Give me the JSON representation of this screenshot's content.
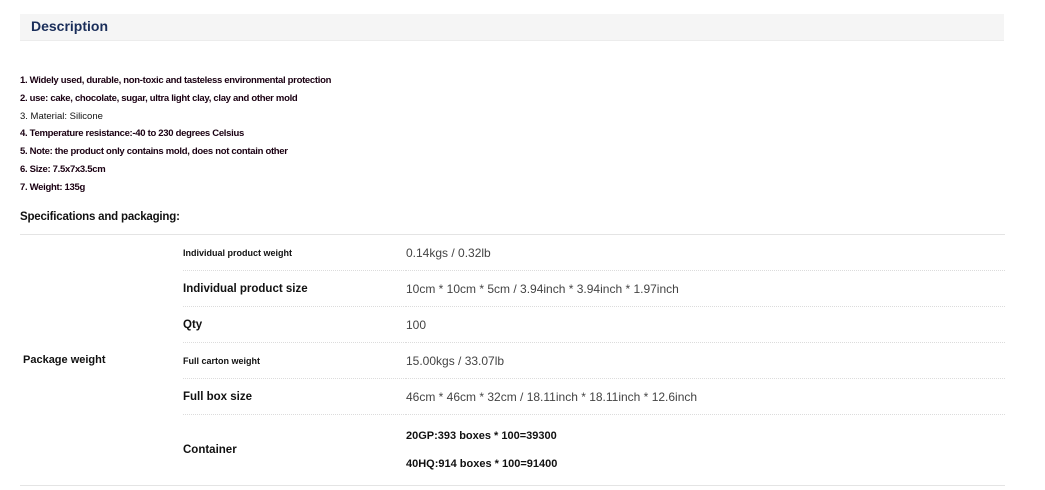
{
  "description": {
    "title": "Description",
    "features": [
      "1. Widely used, durable, non-toxic and tasteless environmental protection",
      "2. use: cake, chocolate, sugar, ultra light clay, clay and other mold",
      "3. Material: Silicone",
      "4. Temperature resistance:-40 to 230 degrees Celsius",
      "5. Note: the product only contains mold, does not contain other",
      "6. Size: 7.5x7x3.5cm",
      "7. Weight: 135g"
    ]
  },
  "specs": {
    "title": "Specifications and packaging:",
    "group_label": "Package weight",
    "rows": [
      {
        "key": "Individual product weight",
        "value": "0.14kgs / 0.32lb"
      },
      {
        "key": "Individual product size",
        "value": "10cm * 10cm * 5cm / 3.94inch * 3.94inch * 1.97inch"
      },
      {
        "key": "Qty",
        "value": "100"
      },
      {
        "key": "Full carton weight",
        "value": "15.00kgs / 33.07lb"
      },
      {
        "key": "Full box size",
        "value": "46cm * 46cm * 32cm / 18.11inch * 18.11inch * 12.6inch"
      }
    ],
    "container": {
      "key": "Container",
      "values": [
        "20GP:393 boxes * 100=39300",
        "40HQ:914 boxes * 100=91400"
      ]
    }
  }
}
